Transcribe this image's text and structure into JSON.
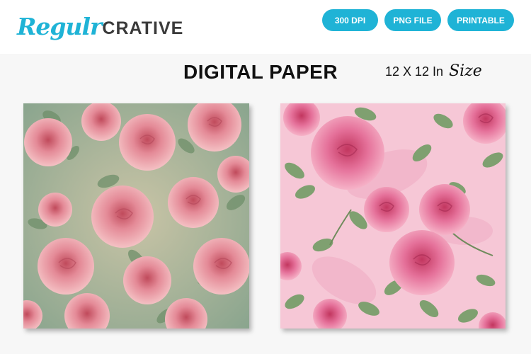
{
  "brand": {
    "script": "Regulr",
    "word": "CRATIVE"
  },
  "badges": [
    "300 DPI",
    "PNG FILE",
    "PRINTABLE"
  ],
  "title": "DIGITAL PAPER",
  "size": {
    "main": "12 X 12 In",
    "script": "Size"
  },
  "colors": {
    "accent": "#1fb3d6",
    "title": "#111111"
  },
  "papers": [
    {
      "name": "vintage-roses-paper",
      "theme": "muted green background with pink roses"
    },
    {
      "name": "pink-roses-paper",
      "theme": "pink background with pink roses and green leaves"
    }
  ]
}
